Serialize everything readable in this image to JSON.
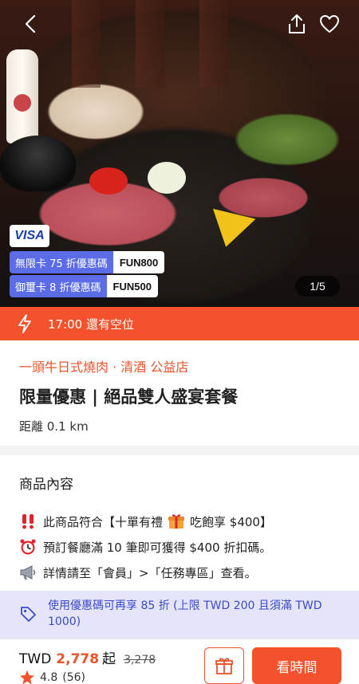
{
  "hero": {
    "card_brand": "VISA",
    "promos": [
      {
        "label": "無限卡 75 折優惠碼",
        "code": "FUN800"
      },
      {
        "label": "御璽卡 8 折優惠碼",
        "code": "FUN500"
      }
    ],
    "image_counter": "1/5"
  },
  "availability": {
    "text": "17:00 還有空位"
  },
  "info": {
    "restaurant": "一頭牛日式燒肉 · 清酒 公益店",
    "title": "限量優惠 | 絕品雙人盛宴套餐",
    "distance": "距離 0.1 km"
  },
  "content": {
    "section_title": "商品內容",
    "lines": [
      "此商品符合【十單有禮",
      "吃飽享 $400】",
      "預訂餐廳滿 10 筆即可獲得 $400 折扣碼。",
      "詳情請至「會員」>「任務專區」查看。"
    ]
  },
  "coupon": {
    "text": "使用優惠碼可再享 85 折 (上限 TWD 200 且須滿 TWD 1000)"
  },
  "bottom": {
    "currency": "TWD",
    "price": "2,778",
    "price_suffix": "起",
    "original_price": "3,278",
    "rating": "4.8",
    "review_count": "(56)",
    "book_label": "看時間"
  },
  "colors": {
    "accent": "#f4522c",
    "promo": "#5b6ce6",
    "coupon_bg": "#e4e5fa",
    "coupon_text": "#3b49c9"
  }
}
